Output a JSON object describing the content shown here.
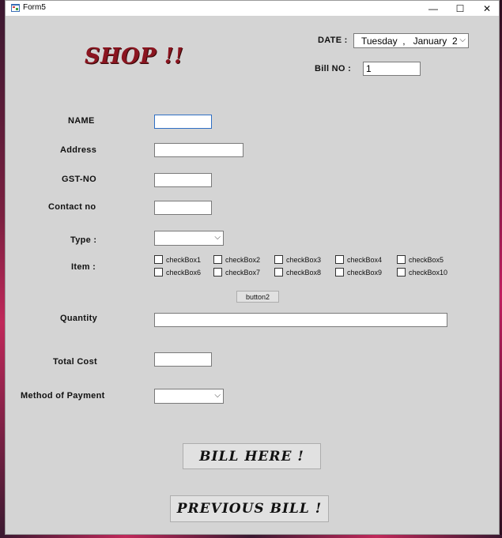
{
  "window": {
    "title": "Form5",
    "minimize_glyph": "—",
    "maximize_glyph": "☐",
    "close_glyph": "✕"
  },
  "header": {
    "shop_title": "SHOP !!",
    "date_label": "DATE  :",
    "date_value": "Tuesday  ,   January  2",
    "bill_no_label": "Bill NO :",
    "bill_no_value": "1"
  },
  "form": {
    "name_label": "NAME",
    "address_label": "Address",
    "gst_label": "GST-NO",
    "contact_label": "Contact no",
    "type_label": "Type :",
    "item_label": "Item :",
    "quantity_label": "Quantity",
    "total_cost_label": "Total Cost",
    "payment_label": "Method  of  Payment",
    "name_value": "",
    "address_value": "",
    "gst_value": "",
    "contact_value": "",
    "quantity_value": "",
    "total_cost_value": "",
    "type_selected": "",
    "payment_selected": ""
  },
  "checkboxes": [
    {
      "label": "checkBox1",
      "checked": false
    },
    {
      "label": "checkBox2",
      "checked": false
    },
    {
      "label": "checkBox3",
      "checked": false
    },
    {
      "label": "checkBox4",
      "checked": false
    },
    {
      "label": "checkBox5",
      "checked": false
    },
    {
      "label": "checkBox6",
      "checked": false
    },
    {
      "label": "checkBox7",
      "checked": false
    },
    {
      "label": "checkBox8",
      "checked": false
    },
    {
      "label": "checkBox9",
      "checked": false
    },
    {
      "label": "checkBox10",
      "checked": false
    }
  ],
  "buttons": {
    "button2": "button2",
    "bill_here": "BILL HERE !",
    "previous_bill": "PREVIOUS  BILL !"
  },
  "colors": {
    "form_bg": "#d4d4d4",
    "shop_title": "#8b1520",
    "focus_border": "#2f6fc4"
  }
}
